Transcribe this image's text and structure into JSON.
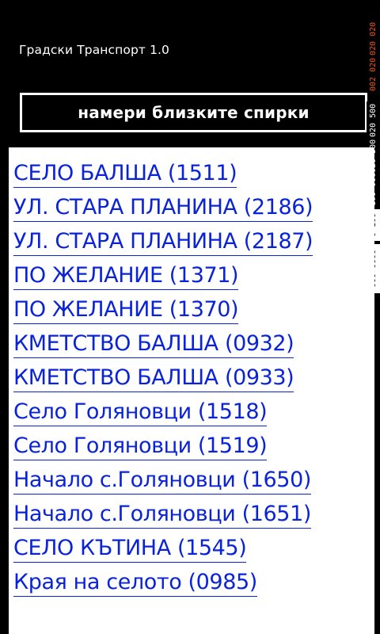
{
  "app": {
    "title": "Градски Транспорт 1.0"
  },
  "actions": {
    "find_nearby_label": "намери близките спирки"
  },
  "stops": [
    "СЕЛО БАЛША (1511)",
    "УЛ. СТАРА ПЛАНИНА (2186)",
    "УЛ. СТАРА ПЛАНИНА (2187)",
    "ПО ЖЕЛАНИЕ (1371)",
    "ПО ЖЕЛАНИЕ (1370)",
    "КМЕТСТВО БАЛША (0932)",
    "КМЕТСТВО БАЛША (0933)",
    "Село Голяновци (1518)",
    "Село Голяновци (1519)",
    "Начало с.Голяновци (1650)",
    "Начало с.Голяновци (1651)",
    "СЕЛО КЪТИНА (1545)",
    "Края на селото (0985)"
  ],
  "perf_counters": [
    "020 020",
    "002 020",
    "020 500",
    "020 500",
    "100 000",
    "0 100",
    "000 0000"
  ],
  "colors": {
    "link": "#0a23d8",
    "counter": "#e8561f"
  }
}
